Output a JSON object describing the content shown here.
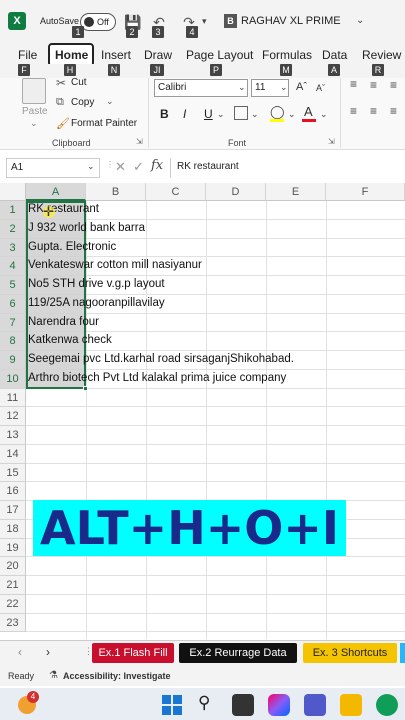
{
  "titlebar": {
    "logo": "X",
    "autosave_label": "AutoSave",
    "toggle_state": "Off",
    "keytips": [
      "1",
      "2",
      "3",
      "4"
    ],
    "user_initial": "B",
    "user_name": "RAGHAV XL PRIME"
  },
  "tabs": [
    {
      "label": "File",
      "key": "F"
    },
    {
      "label": "Home",
      "key": "H"
    },
    {
      "label": "Insert",
      "key": "N"
    },
    {
      "label": "Draw",
      "key": "JI"
    },
    {
      "label": "Page Layout",
      "key": "P"
    },
    {
      "label": "Formulas",
      "key": "M"
    },
    {
      "label": "Data",
      "key": "A"
    },
    {
      "label": "Review",
      "key": "R"
    }
  ],
  "ribbon": {
    "paste": "Paste",
    "cut": "Cut",
    "copy": "Copy",
    "format_painter": "Format Painter",
    "clipboard": "Clipboard",
    "font_name": "Calibri",
    "font_size": "11",
    "bold": "B",
    "italic": "I",
    "underline": "U",
    "font_group": "Font"
  },
  "formula_bar": {
    "name_box": "A1",
    "fx": "fx",
    "content": "RK restaurant"
  },
  "columns": [
    "A",
    "B",
    "C",
    "D",
    "E",
    "F"
  ],
  "rows": [
    "1",
    "2",
    "3",
    "4",
    "5",
    "6",
    "7",
    "8",
    "9",
    "10",
    "11",
    "12",
    "13",
    "14",
    "15",
    "16",
    "17",
    "18",
    "19",
    "20",
    "21",
    "22",
    "23"
  ],
  "cells": [
    "RK restaurant",
    "J 932 world bank barra",
    "Gupta. Electronic",
    "Venkateswar cotton mill nasiyanur",
    "No5 STH drive v.g.p layout",
    "119/25A nagooranpillavilay",
    "Narendra four",
    "Katkenwa check",
    "Seegemai pvc Ltd.karhal road sirsaganjShikohabad.",
    "Arthro biotech Pvt Ltd kalakal prima juice company"
  ],
  "overlay_text": "ALT+H+O+I",
  "sheet_tabs": [
    {
      "label": "Ex.1 Flash Fill",
      "bg": "#c8102e",
      "fg": "#ffffff"
    },
    {
      "label": "Ex.2 Reurrage Data",
      "bg": "#111111",
      "fg": "#ffffff"
    },
    {
      "label": "Ex. 3 Shortcuts",
      "bg": "#f5c400",
      "fg": "#222222"
    }
  ],
  "status": {
    "ready": "Ready",
    "accessibility": "Accessibility: Investigate"
  },
  "taskbar": {
    "badge": "4"
  },
  "colors": {
    "excel_green": "#217346",
    "overlay_bg": "#00ffff",
    "overlay_text": "#1a2a8a"
  }
}
